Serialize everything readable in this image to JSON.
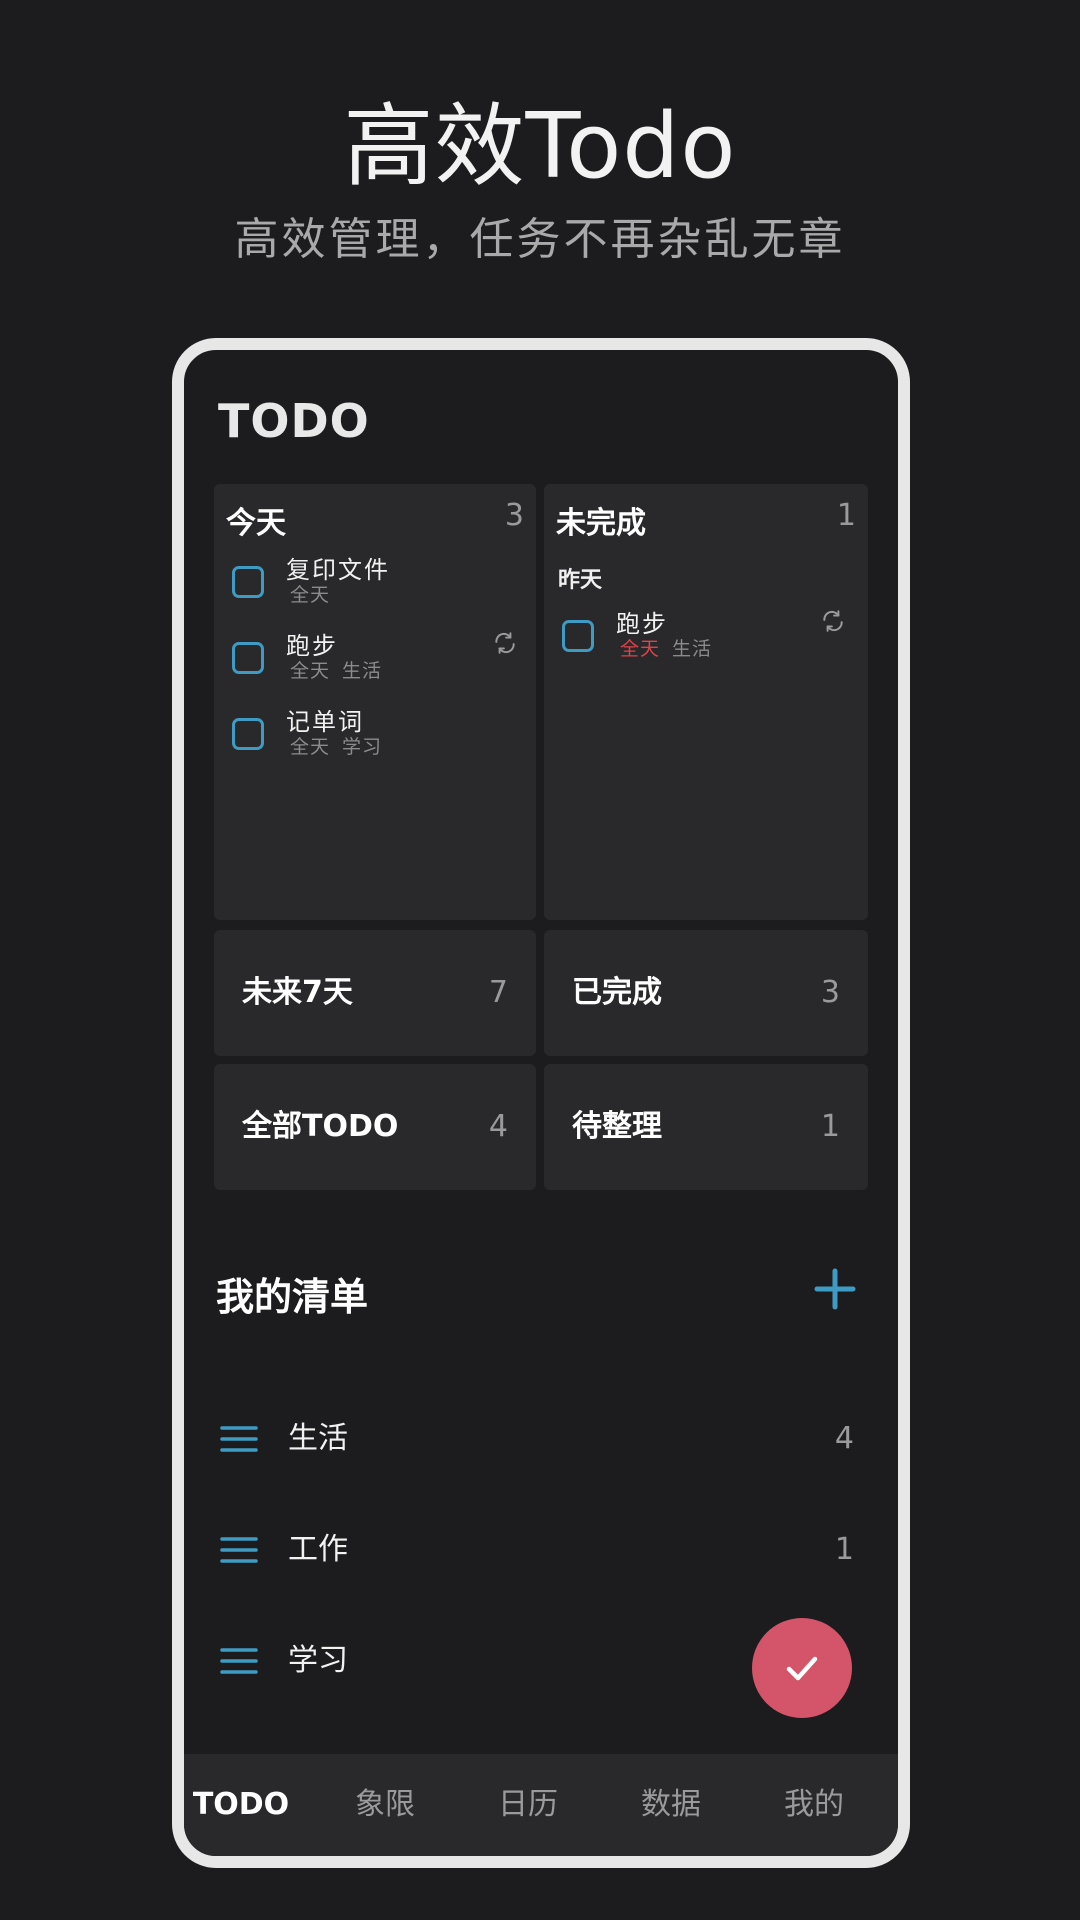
{
  "promo": {
    "title": "高效Todo",
    "subtitle": "高效管理，任务不再杂乱无章"
  },
  "app": {
    "title": "TODO"
  },
  "today": {
    "title": "今天",
    "count": "3",
    "tasks": [
      {
        "name": "复印文件",
        "time": "全天",
        "tag": "",
        "repeat": false
      },
      {
        "name": "跑步",
        "time": "全天",
        "tag": "生活",
        "repeat": true
      },
      {
        "name": "记单词",
        "time": "全天",
        "tag": "学习",
        "repeat": false
      }
    ]
  },
  "incomplete": {
    "title": "未完成",
    "count": "1",
    "section": "昨天",
    "tasks": [
      {
        "name": "跑步",
        "time": "全天",
        "tag": "生活",
        "repeat": true,
        "overdue": true
      }
    ]
  },
  "smart_lists": [
    {
      "title": "未来7天",
      "count": "7"
    },
    {
      "title": "已完成",
      "count": "3"
    },
    {
      "title": "全部TODO",
      "count": "4"
    },
    {
      "title": "待整理",
      "count": "1"
    }
  ],
  "my_lists": {
    "title": "我的清单",
    "items": [
      {
        "name": "生活",
        "count": "4"
      },
      {
        "name": "工作",
        "count": "1"
      },
      {
        "name": "学习",
        "count": ""
      }
    ]
  },
  "tabs": [
    {
      "label": "TODO",
      "active": true
    },
    {
      "label": "象限",
      "active": false
    },
    {
      "label": "日历",
      "active": false
    },
    {
      "label": "数据",
      "active": false
    },
    {
      "label": "我的",
      "active": false
    }
  ],
  "colors": {
    "accent": "#3d9bc4",
    "overdue": "#e0414a",
    "fab": "#d4556a",
    "card": "#29292b",
    "background": "#1c1c1e"
  },
  "icons": {
    "repeat": "repeat-icon",
    "add": "plus-icon",
    "list": "menu-icon",
    "fab": "check-icon"
  }
}
